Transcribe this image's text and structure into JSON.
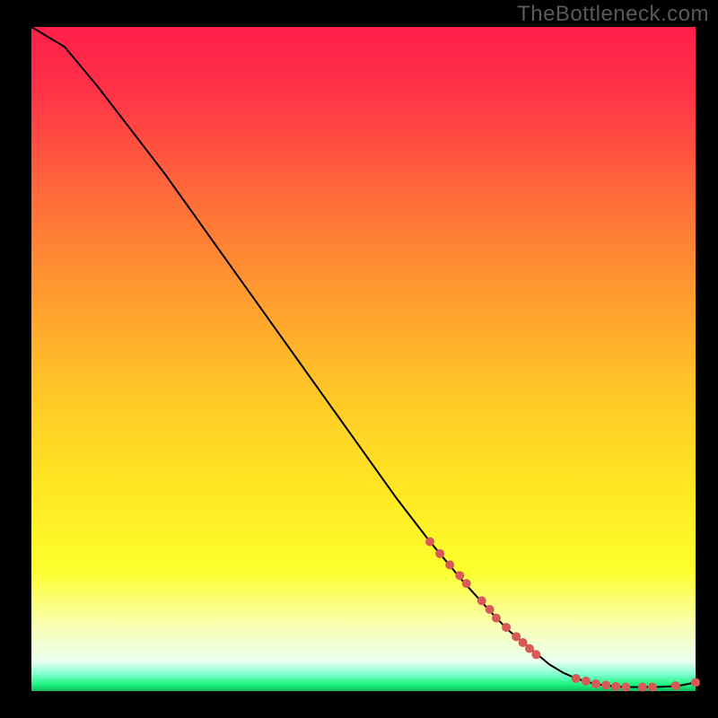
{
  "watermark": "TheBottleneck.com",
  "chart_data": {
    "type": "line",
    "title": "",
    "xlabel": "",
    "ylabel": "",
    "xlim": [
      0,
      100
    ],
    "ylim": [
      0,
      100
    ],
    "series": [
      {
        "name": "curve",
        "x": [
          0,
          5,
          10,
          15,
          20,
          25,
          30,
          35,
          40,
          45,
          50,
          55,
          60,
          65,
          70,
          72,
          75,
          78,
          80,
          82,
          84,
          86,
          88,
          90,
          92,
          94,
          96,
          98,
          100
        ],
        "y": [
          100,
          97,
          91,
          84.5,
          78,
          71,
          64,
          57,
          50,
          43,
          36,
          29,
          22.5,
          16.5,
          11,
          9,
          6.5,
          4,
          2.8,
          1.9,
          1.3,
          0.9,
          0.7,
          0.6,
          0.6,
          0.6,
          0.7,
          0.9,
          1.3
        ]
      }
    ],
    "markers": {
      "name": "highlighted-points",
      "color": "#d85a56",
      "points": [
        {
          "x": 60.0,
          "y": 22.5,
          "r": 5
        },
        {
          "x": 61.5,
          "y": 20.7,
          "r": 5
        },
        {
          "x": 63.0,
          "y": 19.0,
          "r": 5
        },
        {
          "x": 64.5,
          "y": 17.4,
          "r": 5
        },
        {
          "x": 65.5,
          "y": 16.2,
          "r": 5
        },
        {
          "x": 67.8,
          "y": 13.6,
          "r": 5
        },
        {
          "x": 69.0,
          "y": 12.3,
          "r": 5
        },
        {
          "x": 70.0,
          "y": 11.0,
          "r": 5
        },
        {
          "x": 71.5,
          "y": 9.6,
          "r": 5
        },
        {
          "x": 73.0,
          "y": 8.2,
          "r": 5
        },
        {
          "x": 74.0,
          "y": 7.3,
          "r": 5
        },
        {
          "x": 75.0,
          "y": 6.4,
          "r": 5
        },
        {
          "x": 76.0,
          "y": 5.5,
          "r": 5
        },
        {
          "x": 82.0,
          "y": 1.9,
          "r": 5
        },
        {
          "x": 83.5,
          "y": 1.5,
          "r": 5
        },
        {
          "x": 85.0,
          "y": 1.1,
          "r": 5
        },
        {
          "x": 86.5,
          "y": 0.9,
          "r": 5
        },
        {
          "x": 88.0,
          "y": 0.7,
          "r": 5
        },
        {
          "x": 89.5,
          "y": 0.6,
          "r": 5
        },
        {
          "x": 92.0,
          "y": 0.6,
          "r": 5
        },
        {
          "x": 93.5,
          "y": 0.6,
          "r": 5
        },
        {
          "x": 97.0,
          "y": 0.8,
          "r": 5
        },
        {
          "x": 100.0,
          "y": 1.3,
          "r": 5
        }
      ]
    },
    "background_gradient": {
      "stops": [
        {
          "pos": 0.0,
          "color": "#ff1f4b"
        },
        {
          "pos": 0.1,
          "color": "#ff3347"
        },
        {
          "pos": 0.25,
          "color": "#ff6a3a"
        },
        {
          "pos": 0.4,
          "color": "#ff9a2f"
        },
        {
          "pos": 0.55,
          "color": "#ffc727"
        },
        {
          "pos": 0.7,
          "color": "#ffe822"
        },
        {
          "pos": 0.82,
          "color": "#fcff2e"
        },
        {
          "pos": 0.9,
          "color": "#faffb0"
        },
        {
          "pos": 0.955,
          "color": "#eafff0"
        },
        {
          "pos": 0.975,
          "color": "#7dffd0"
        },
        {
          "pos": 0.99,
          "color": "#1cf57e"
        },
        {
          "pos": 1.0,
          "color": "#0fba5f"
        }
      ]
    }
  }
}
